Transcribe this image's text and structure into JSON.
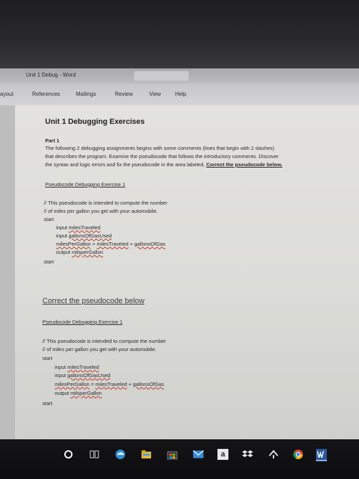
{
  "window": {
    "title": "Unit 1 Debug  -  Word"
  },
  "ribbon": {
    "tabs": [
      "ayout",
      "References",
      "Mailings",
      "Review",
      "View",
      "Help"
    ]
  },
  "doc": {
    "title": "Unit 1 Debugging Exercises",
    "part_label": "Part 1",
    "intro_line1": "The following 2 debugging assignments begins with some comments (lines that begin with 2 slashes)",
    "intro_line2": "that describes the program. Examine the pseudocode that follows the introductory comments. Discover",
    "intro_line3_pre": "the syntax and logic errors and fix the pseudocode in the area labeled,",
    "intro_line3_link": "Correct the pseudocode below.",
    "exercise_heading_1": "Pseudocode Debugging Exercise 1",
    "code1": {
      "comment1": "// This pseudocode is intended to compute the number",
      "comment2": "// of miles per gallon you get with your automobile.",
      "start": "start",
      "l1_kw": "input ",
      "l1_var": "milesTraveled",
      "l2_kw": "input ",
      "l2_var": "gallonsOfGasUsed",
      "l3_a": "milesPerGallon",
      "l3_eq": " = ",
      "l3_b": "milesTraveled",
      "l3_plus": " + ",
      "l3_c": "gallonsOfGas",
      "l4_kw": "output ",
      "l4_var": "milsperGallon",
      "end": "start"
    },
    "correct_heading": "Correct the pseudocode below",
    "exercise_heading_2": "Pseudocode Debugging Exercise 1",
    "code2": {
      "comment1": "// This pseudocode is intended to compute the number",
      "comment2": "// of miles per gallon you get with your automobile.",
      "start": "start",
      "l1_kw": "input ",
      "l1_var": "milesTraveled",
      "l2_kw": "input ",
      "l2_var": "gallonsOfGasUsed",
      "l3_a": "milesPerGallon",
      "l3_eq": " = ",
      "l3_b": "milesTraveled",
      "l3_plus": " + ",
      "l3_c": "gallonsOfGas",
      "l4_kw": "output ",
      "l4_var": "milsperGallon",
      "end": "start"
    }
  },
  "taskbar": {
    "icons": [
      "cortana-icon",
      "task-view-icon",
      "edge-icon",
      "file-explorer-icon",
      "store-icon",
      "mail-icon",
      "amazon-icon",
      "dropbox-icon",
      "app-icon",
      "chrome-icon",
      "word-icon"
    ],
    "amazon_glyph": "a"
  },
  "colors": {
    "squiggle": "#c0392b",
    "word_blue": "#2b579a"
  }
}
